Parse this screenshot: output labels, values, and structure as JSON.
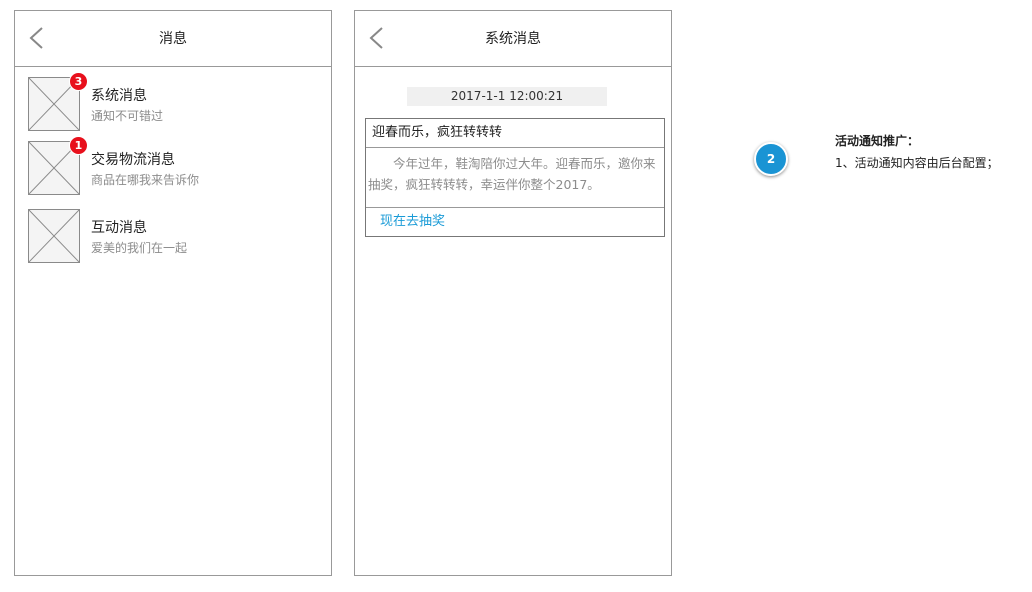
{
  "messages_screen": {
    "title": "消息",
    "items": [
      {
        "title": "系统消息",
        "subtitle": "通知不可错过",
        "badge": "3"
      },
      {
        "title": "交易物流消息",
        "subtitle": "商品在哪我来告诉你",
        "badge": "1"
      },
      {
        "title": "互动消息",
        "subtitle": "爱美的我们在一起"
      }
    ]
  },
  "system_screen": {
    "title": "系统消息",
    "timestamp": "2017-1-1 12:00:21",
    "card": {
      "title": "迎春而乐，疯狂转转转",
      "body": "今年过年，鞋淘陪你过大年。迎春而乐，邀你来抽奖，疯狂转转转，幸运伴你整个2017。",
      "action": "现在去抽奖"
    }
  },
  "annotation": {
    "marker": "2",
    "title": "活动通知推广：",
    "line": "1、活动通知内容由后台配置；"
  },
  "colors": {
    "badge": "#e8101c",
    "link": "#1a9bd7",
    "marker": "#1a94d4"
  }
}
